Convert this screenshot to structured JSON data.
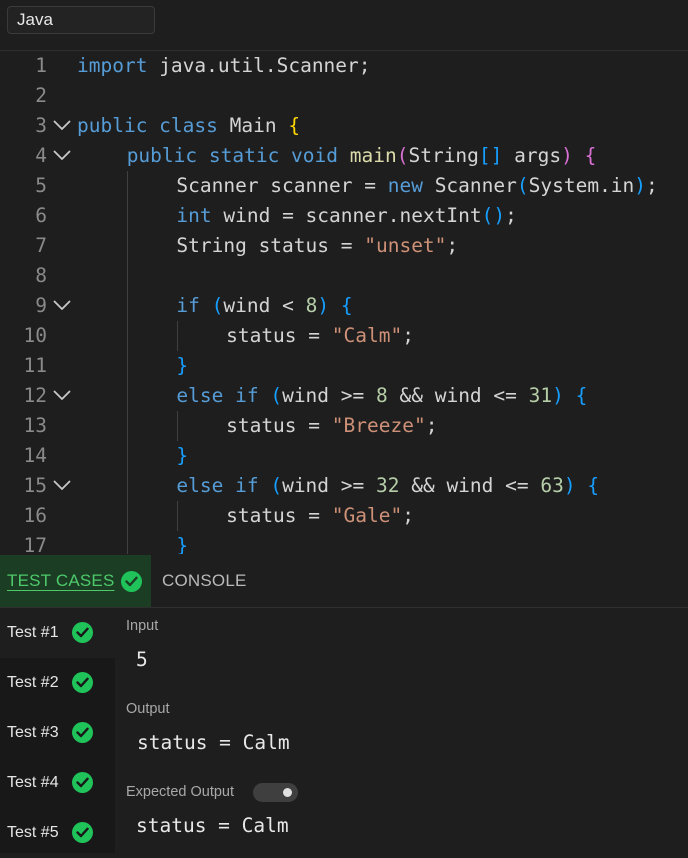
{
  "header": {
    "language": "Java"
  },
  "editor": {
    "lines": [
      {
        "n": "1",
        "fold": false,
        "indent": 0,
        "tokens": [
          {
            "t": "import",
            "c": "kw"
          },
          {
            "t": " java.util.Scanner;",
            "c": ""
          }
        ]
      },
      {
        "n": "2",
        "fold": false,
        "indent": 0,
        "tokens": []
      },
      {
        "n": "3",
        "fold": true,
        "indent": 0,
        "tokens": [
          {
            "t": "public class",
            "c": "kw"
          },
          {
            "t": " Main ",
            "c": ""
          },
          {
            "t": "{",
            "c": "b1"
          }
        ]
      },
      {
        "n": "4",
        "fold": true,
        "indent": 1,
        "tokens": [
          {
            "t": "public static void",
            "c": "kw"
          },
          {
            "t": " main",
            "c": "fn"
          },
          {
            "t": "(",
            "c": "b2"
          },
          {
            "t": "String",
            "c": ""
          },
          {
            "t": "[]",
            "c": "b3"
          },
          {
            "t": " args",
            "c": ""
          },
          {
            "t": ")",
            "c": "b2"
          },
          {
            "t": " ",
            "c": ""
          },
          {
            "t": "{",
            "c": "b2"
          }
        ]
      },
      {
        "n": "5",
        "fold": false,
        "indent": 2,
        "tokens": [
          {
            "t": "Scanner scanner = ",
            "c": ""
          },
          {
            "t": "new",
            "c": "kw"
          },
          {
            "t": " Scanner",
            "c": ""
          },
          {
            "t": "(",
            "c": "b3"
          },
          {
            "t": "System.in",
            "c": ""
          },
          {
            "t": ")",
            "c": "b3"
          },
          {
            "t": ";",
            "c": ""
          }
        ]
      },
      {
        "n": "6",
        "fold": false,
        "indent": 2,
        "tokens": [
          {
            "t": "int",
            "c": "kw"
          },
          {
            "t": " wind = scanner.nextInt",
            "c": ""
          },
          {
            "t": "()",
            "c": "b3"
          },
          {
            "t": ";",
            "c": ""
          }
        ]
      },
      {
        "n": "7",
        "fold": false,
        "indent": 2,
        "tokens": [
          {
            "t": "String status = ",
            "c": ""
          },
          {
            "t": "\"unset\"",
            "c": "str"
          },
          {
            "t": ";",
            "c": ""
          }
        ]
      },
      {
        "n": "8",
        "fold": false,
        "indent": 2,
        "tokens": []
      },
      {
        "n": "9",
        "fold": true,
        "indent": 2,
        "tokens": [
          {
            "t": "if",
            "c": "kw"
          },
          {
            "t": " ",
            "c": ""
          },
          {
            "t": "(",
            "c": "b3"
          },
          {
            "t": "wind < ",
            "c": ""
          },
          {
            "t": "8",
            "c": "num"
          },
          {
            "t": ")",
            "c": "b3"
          },
          {
            "t": " ",
            "c": ""
          },
          {
            "t": "{",
            "c": "b3"
          }
        ]
      },
      {
        "n": "10",
        "fold": false,
        "indent": 3,
        "tokens": [
          {
            "t": "status = ",
            "c": ""
          },
          {
            "t": "\"Calm\"",
            "c": "str"
          },
          {
            "t": ";",
            "c": ""
          }
        ]
      },
      {
        "n": "11",
        "fold": false,
        "indent": 2,
        "tokens": [
          {
            "t": "}",
            "c": "b3"
          }
        ]
      },
      {
        "n": "12",
        "fold": true,
        "indent": 2,
        "tokens": [
          {
            "t": "else if",
            "c": "kw"
          },
          {
            "t": " ",
            "c": ""
          },
          {
            "t": "(",
            "c": "b3"
          },
          {
            "t": "wind >= ",
            "c": ""
          },
          {
            "t": "8",
            "c": "num"
          },
          {
            "t": " && wind <= ",
            "c": ""
          },
          {
            "t": "31",
            "c": "num"
          },
          {
            "t": ")",
            "c": "b3"
          },
          {
            "t": " ",
            "c": ""
          },
          {
            "t": "{",
            "c": "b3"
          }
        ]
      },
      {
        "n": "13",
        "fold": false,
        "indent": 3,
        "tokens": [
          {
            "t": "status = ",
            "c": ""
          },
          {
            "t": "\"Breeze\"",
            "c": "str"
          },
          {
            "t": ";",
            "c": ""
          }
        ]
      },
      {
        "n": "14",
        "fold": false,
        "indent": 2,
        "tokens": [
          {
            "t": "}",
            "c": "b3"
          }
        ]
      },
      {
        "n": "15",
        "fold": true,
        "indent": 2,
        "tokens": [
          {
            "t": "else if",
            "c": "kw"
          },
          {
            "t": " ",
            "c": ""
          },
          {
            "t": "(",
            "c": "b3"
          },
          {
            "t": "wind >= ",
            "c": ""
          },
          {
            "t": "32",
            "c": "num"
          },
          {
            "t": " && wind <= ",
            "c": ""
          },
          {
            "t": "63",
            "c": "num"
          },
          {
            "t": ")",
            "c": "b3"
          },
          {
            "t": " ",
            "c": ""
          },
          {
            "t": "{",
            "c": "b3"
          }
        ]
      },
      {
        "n": "16",
        "fold": false,
        "indent": 3,
        "tokens": [
          {
            "t": "status = ",
            "c": ""
          },
          {
            "t": "\"Gale\"",
            "c": "str"
          },
          {
            "t": ";",
            "c": ""
          }
        ]
      },
      {
        "n": "17",
        "fold": false,
        "indent": 2,
        "tokens": [
          {
            "t": "}",
            "c": "b3"
          }
        ]
      }
    ]
  },
  "tabs": {
    "test_cases": "TEST CASES",
    "console": "CONSOLE"
  },
  "tests": [
    {
      "label": "Test #1",
      "status": "passed"
    },
    {
      "label": "Test #2",
      "status": "passed"
    },
    {
      "label": "Test #3",
      "status": "passed"
    },
    {
      "label": "Test #4",
      "status": "passed"
    },
    {
      "label": "Test #5",
      "status": "passed"
    }
  ],
  "result": {
    "input_label": "Input",
    "input_value": "5",
    "output_label": "Output",
    "output_value": "status = Calm",
    "expected_label": "Expected Output",
    "expected_value": "status = Calm"
  },
  "colors": {
    "pass": "#1fc35a",
    "active_tab_bg": "#1a3d24"
  },
  "icons": {
    "fold": "chevron-down-icon",
    "status": "check-circle-icon"
  }
}
